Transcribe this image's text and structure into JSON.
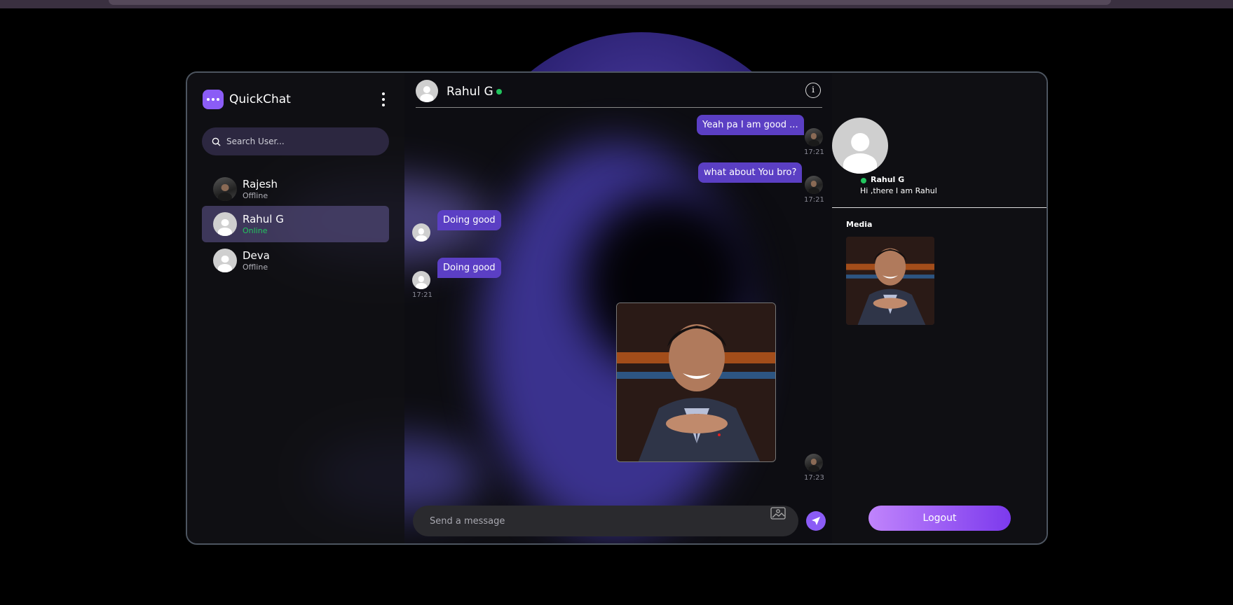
{
  "app": {
    "name": "QuickChat"
  },
  "search": {
    "placeholder": "Search User..."
  },
  "users": [
    {
      "name": "Rajesh",
      "status": "Offline"
    },
    {
      "name": "Rahul G",
      "status": "Online"
    },
    {
      "name": "Deva",
      "status": "Offline"
    }
  ],
  "chat": {
    "contact_name": "Rahul G",
    "messages": [
      {
        "text": "Yeah pa I am good ...",
        "time": "17:21",
        "direction": "out"
      },
      {
        "text": "what about You bro?",
        "time": "17:21",
        "direction": "out"
      },
      {
        "text": "Doing good",
        "time": "",
        "direction": "in"
      },
      {
        "text": "Doing good",
        "time": "17:21",
        "direction": "in"
      },
      {
        "text": "",
        "time": "17:23",
        "direction": "out",
        "type": "image"
      }
    ],
    "composer_placeholder": "Send a message"
  },
  "profile": {
    "name": "Rahul G",
    "bio": "Hi ,there I am Rahul",
    "media_label": "Media"
  },
  "logout_label": "Logout",
  "colors": {
    "accent": "#8b5cf6",
    "online": "#22c55e",
    "bubble": "#5b3fc4"
  }
}
